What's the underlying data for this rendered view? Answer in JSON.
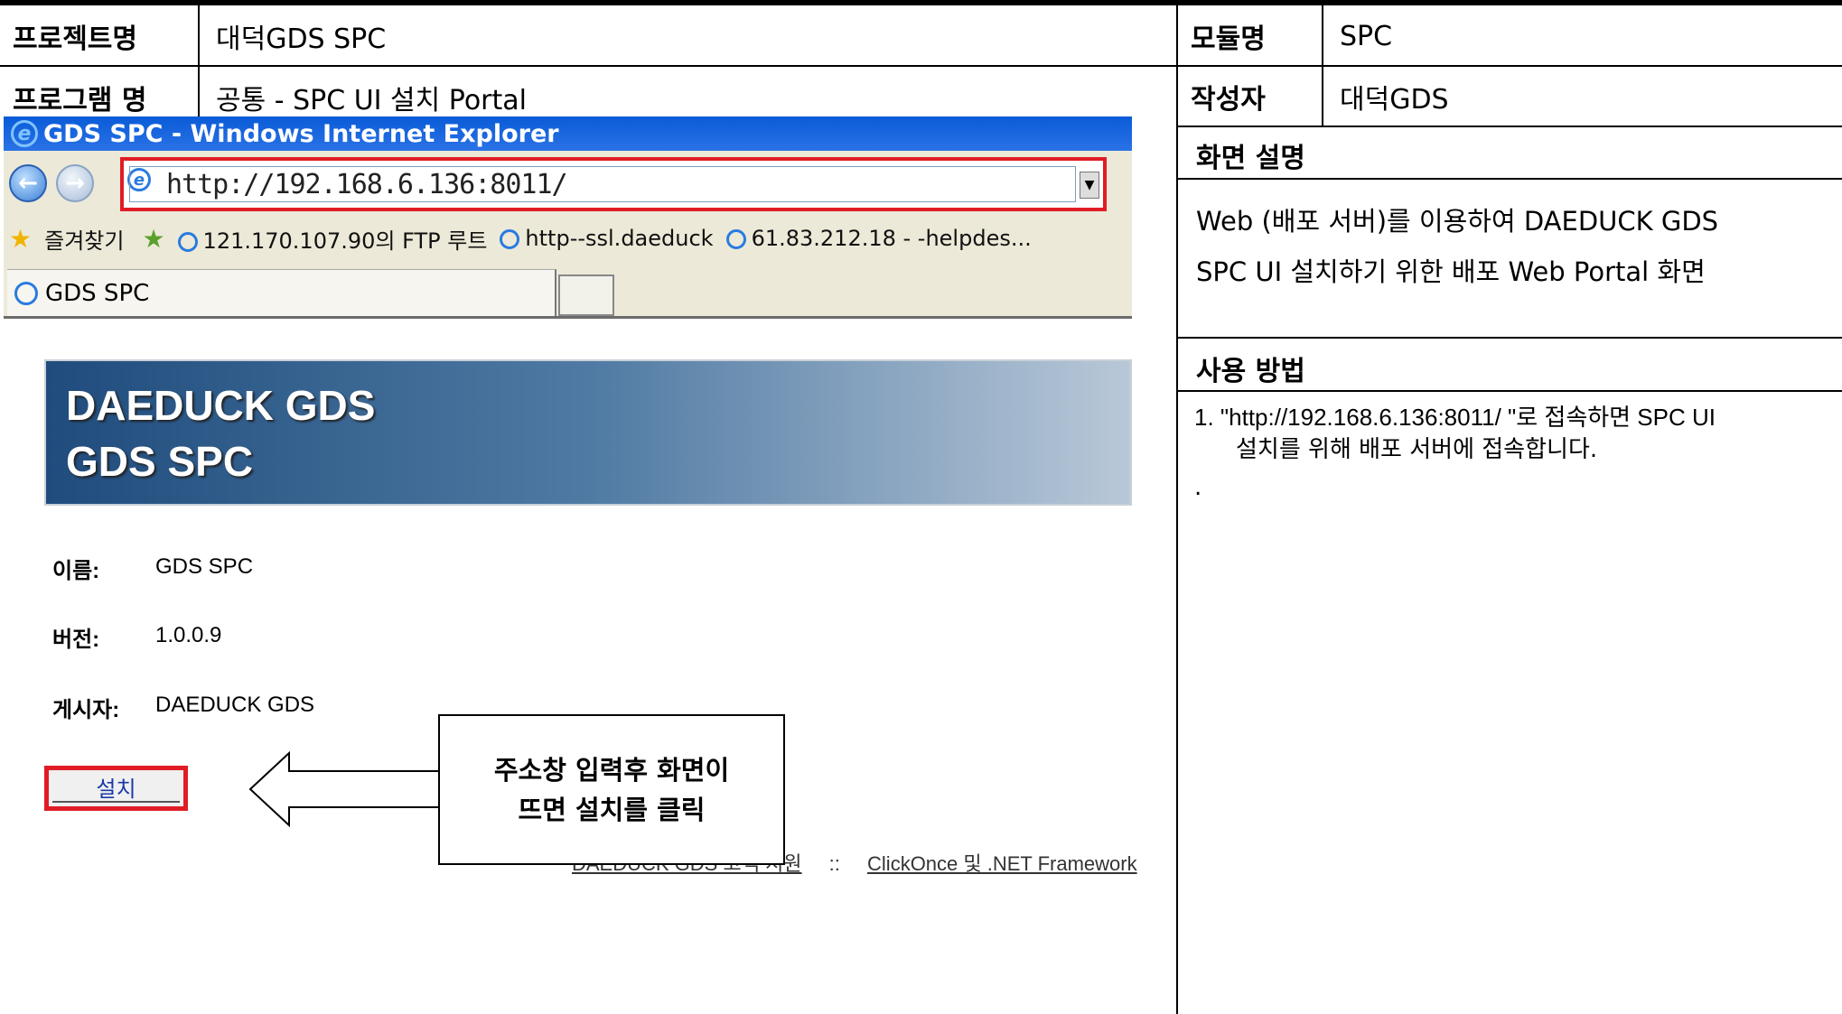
{
  "header": {
    "project_label": "프로젝트명",
    "project_value": "대덕GDS SPC",
    "module_label": "모듈명",
    "module_value": "SPC",
    "program_label": "프로그램 명",
    "program_value": "공통 - SPC UI 설치 Portal",
    "author_label": "작성자",
    "author_value": "대덕GDS"
  },
  "browser": {
    "window_title": "GDS SPC - Windows Internet Explorer",
    "address_url": "http://192.168.6.136:8011/",
    "favorites_label": "즐겨찾기",
    "favorites": [
      "121.170.107.90의 FTP 루트",
      "http--ssl.daeduck",
      "61.83.212.18 - -helpdes..."
    ],
    "tab_title": "GDS SPC"
  },
  "portal": {
    "banner_line1": "DAEDUCK GDS",
    "banner_line2": "GDS SPC",
    "name_label": "이름:",
    "name_value": "GDS SPC",
    "version_label": "버전:",
    "version_value": "1.0.0.9",
    "publisher_label": "게시자:",
    "publisher_value": "DAEDUCK GDS",
    "install_button": "설치",
    "footer_link1": "DAEDUCK GDS 고객 지원",
    "footer_sep": "::",
    "footer_link2": "ClickOnce 및 .NET Framework"
  },
  "callout": {
    "line1": "주소창 입력후 화면이",
    "line2": "뜨면 설치를 클릭"
  },
  "right_panel": {
    "screen_desc_title": "화면 설명",
    "screen_desc_line1": "Web (배포 서버)를 이용하여 DAEDUCK GDS",
    "screen_desc_line2": "SPC UI 설치하기 위한 배포 Web Portal 화면",
    "usage_title": "사용 방법",
    "usage_line1": "1. \"http://192.168.6.136:8011/ \"로 접속하면 SPC UI",
    "usage_line2": "설치를 위해 배포 서버에 접속합니다.",
    "usage_dot": "."
  },
  "colors": {
    "highlight_red": "#e01c24",
    "ie_title_blue": "#0a5bd8",
    "banner_dark": "#1f4c7d"
  }
}
